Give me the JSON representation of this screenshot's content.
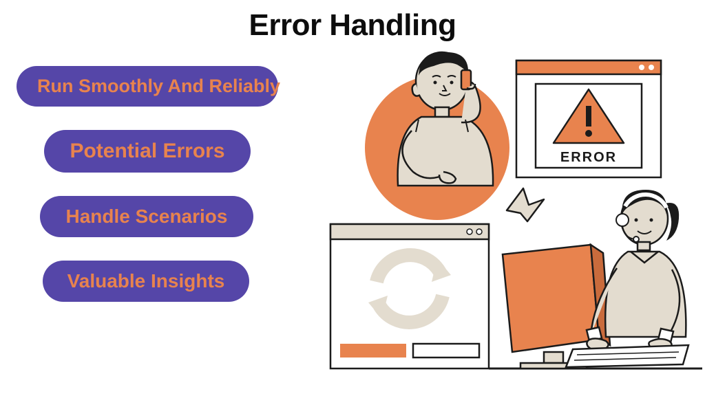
{
  "title": "Error Handling",
  "pills": [
    {
      "label": "Run Smoothly And Reliably"
    },
    {
      "label": "Potential Errors"
    },
    {
      "label": "Handle Scenarios"
    },
    {
      "label": "Valuable Insights"
    }
  ],
  "illustration": {
    "error_label": "ERROR",
    "icons": {
      "warning": "warning-triangle-icon",
      "refresh": "refresh-arrows-icon",
      "cursor": "cursor-pointer-icon"
    }
  },
  "colors": {
    "pill_bg": "#5546a8",
    "pill_text": "#e8834e",
    "accent_orange": "#e8834e",
    "beige": "#e3dccf",
    "dark": "#1b1b1b"
  }
}
